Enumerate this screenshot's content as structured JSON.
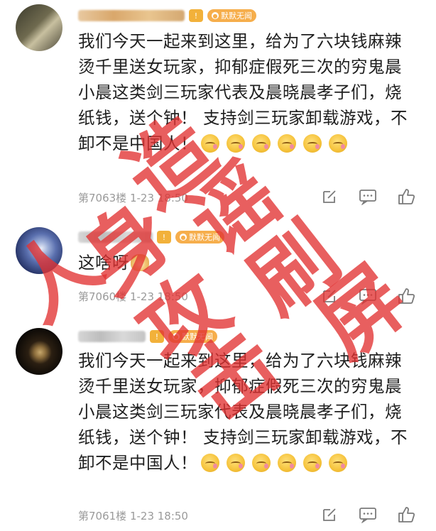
{
  "comments": [
    {
      "badge": "默默无闻",
      "level": "!",
      "text": "我们今天一起来到这里，给为了六块钱麻辣烫千里送女玩家，抑郁症假死三次的穷鬼晨小晨这类剑三玩家代表及晨晓晨孝子们，烧纸钱，送个钟！ 支持剑三玩家卸载游戏，不卸不是中国人！",
      "meta": "第7063楼  1-23  18:50"
    },
    {
      "badge": "默默无闻",
      "level": "!",
      "text": "这啥呀",
      "meta": "第7060楼  1-23  18:50"
    },
    {
      "badge": "默默无闻",
      "level": "!",
      "text": "我们今天一起来到这里，给为了六块钱麻辣烫千里送女玩家，抑郁症假死三次的穷鬼晨小晨这类剑三玩家代表及晨晓晨孝子们，烧纸钱，送个钟！ 支持剑三玩家卸载游戏，不卸不是中国人！",
      "meta": "第7061楼  1-23  18:50"
    }
  ],
  "watermark": [
    "人",
    "身",
    "攻",
    "击",
    "造",
    "谣",
    "刷",
    "屏"
  ],
  "colors": {
    "badge": "#f6ae4c",
    "watermark": "#e23232",
    "meta": "#9a9a9a"
  },
  "icons": {
    "edit": "edit-icon",
    "reply": "comment-icon",
    "like": "thumbs-up-icon",
    "emoji": "smiling-face-emoji",
    "doge": "doge-emoji"
  }
}
